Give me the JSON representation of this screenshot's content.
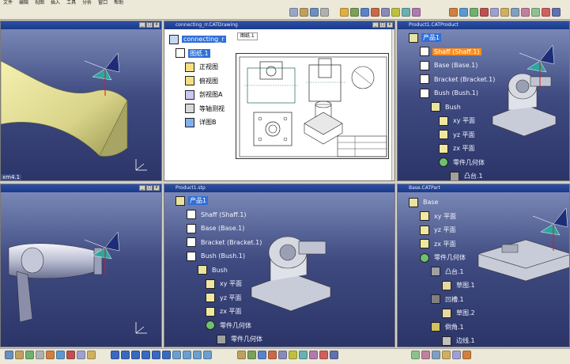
{
  "menu": [
    "文件",
    "编辑",
    "视图",
    "插入",
    "工具",
    "分析",
    "窗口",
    "帮助"
  ],
  "windows": {
    "top_left": {
      "title": ""
    },
    "top_middle": {
      "title": "connecting_rr.CATDrawing",
      "sheet_tab": "图纸.1"
    },
    "top_right": {
      "title": "Product1.CATProduct"
    },
    "bottom_left": {
      "title": ""
    },
    "bottom_middle": {
      "title": "Product1.stp"
    },
    "bottom_right": {
      "title": "Base.CATPart"
    }
  },
  "drawing_tree": {
    "root": "connecting_r",
    "sheet": "图纸.1",
    "views": [
      "正视图",
      "俯视图",
      "剖视图A",
      "等轴测视",
      "详图B"
    ]
  },
  "product_tree_top": {
    "root": "产品1",
    "items": [
      "Shaff (Shaff.1)",
      "Base (Base.1)",
      "Bracket (Bracket.1)",
      "Bush (Bush.1)"
    ],
    "sub_root": "Bush",
    "planes": [
      "xy 平面",
      "yz 平面",
      "zx 平面"
    ],
    "body": "零件几何体",
    "feature": "凸台.1"
  },
  "product_tree_bottom": {
    "root": "产品1",
    "items": [
      "Shaff (Shaff.1)",
      "Base (Base.1)",
      "Bracket (Bracket.1)",
      "Bush (Bush.1)"
    ],
    "sub_root": "Bush",
    "planes": [
      "xy 平面",
      "yz 平面",
      "zx 平面"
    ],
    "body": "零件几何体",
    "feature": "零件几何体"
  },
  "part_tree": {
    "root": "Base",
    "planes": [
      "xy 平面",
      "yz 平面",
      "zx 平面"
    ],
    "body": "零件几何体",
    "features": [
      "凸台.1",
      "草图.1",
      "凹槽.1",
      "草图.2",
      "倒角.1",
      "边线.1"
    ]
  },
  "label_bottom_left_tl": "xm4.1",
  "colors": {
    "title_bar": "#1c3a86",
    "viewport_top": "#7987b6",
    "viewport_bottom": "#2c3568",
    "selection": "#2f6fd8",
    "highlight": "#ff8c1a"
  }
}
